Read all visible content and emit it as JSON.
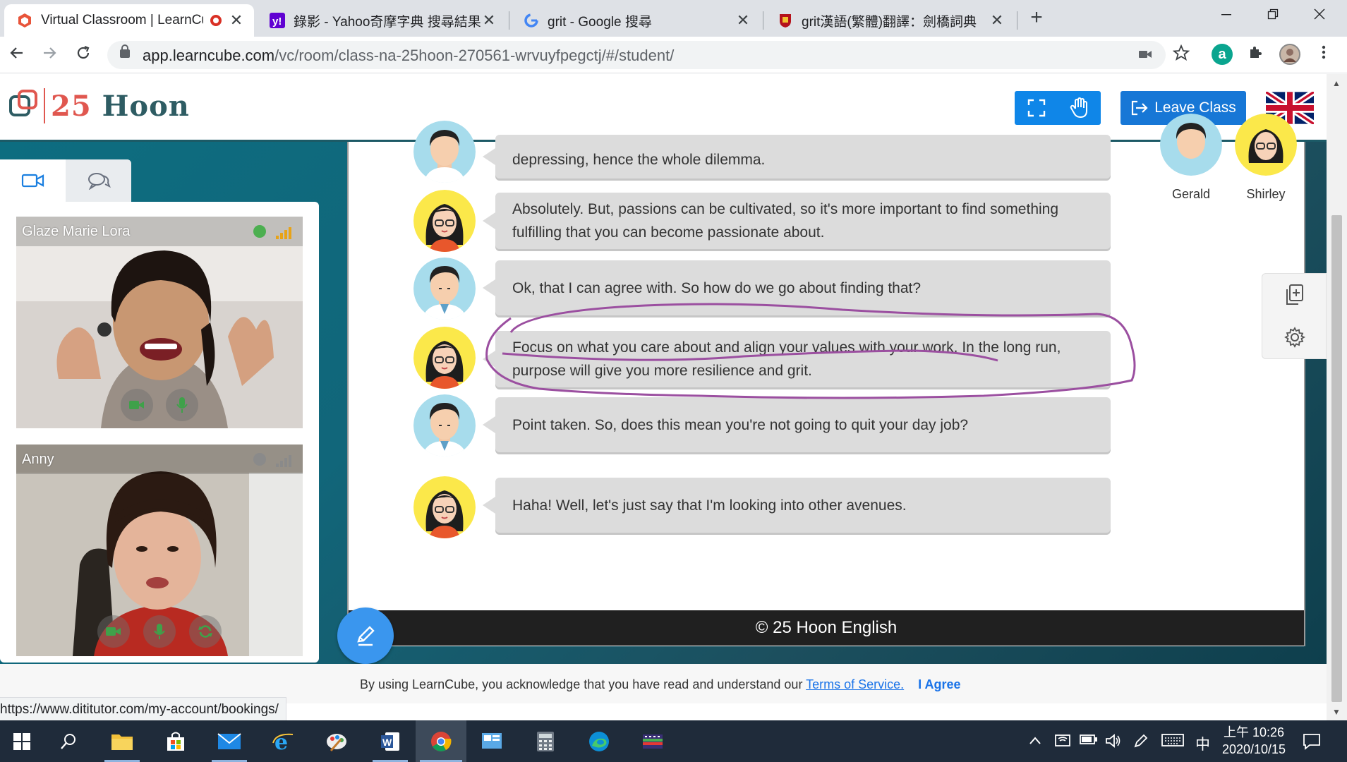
{
  "browser": {
    "tabs": [
      {
        "title": "Virtual Classroom | LearnCube",
        "favicon": "learncube-icon"
      },
      {
        "title": "錄影 - Yahoo奇摩字典 搜尋結果",
        "favicon": "yahoo-icon"
      },
      {
        "title": "grit - Google 搜尋",
        "favicon": "google-icon"
      },
      {
        "title": "grit漢語(繁體)翻譯：劍橋詞典",
        "favicon": "cambridge-icon"
      }
    ],
    "close_glyph": "✕",
    "new_tab_glyph": "+",
    "url_host": "app.learncube.com",
    "url_path": "/vc/room/class-na-25hoon-270561-wrvuyfpegctj/#/student/",
    "extension_letter": "a"
  },
  "app": {
    "logo_num": "25",
    "logo_word": "Hoon",
    "leave_label": "Leave Class",
    "accent_color": "#0f86e8"
  },
  "participants": [
    {
      "name": "Glaze Marie Lora",
      "status_color": "#4caf50",
      "signal_color": "#e8a317"
    },
    {
      "name": "Anny",
      "status_color": "#8a8a8a",
      "signal_color": "#8a8a8a"
    }
  ],
  "lesson": {
    "characters": [
      {
        "name": "Gerald"
      },
      {
        "name": "Shirley"
      }
    ],
    "dialogue": [
      {
        "speaker": "gerald",
        "text": "depressing, hence the whole dilemma."
      },
      {
        "speaker": "shirley",
        "text": "Absolutely. But, passions can be cultivated, so it's more important to find something fulfilling that you can become passionate about."
      },
      {
        "speaker": "gerald",
        "text": "Ok, that I can agree with. So how do we go about finding that?"
      },
      {
        "speaker": "shirley",
        "text": "Focus on what you care about and align your values with your work. In the long run, purpose will give you more resilience and grit."
      },
      {
        "speaker": "gerald",
        "text": "Point taken. So, does this mean you're not going to quit your day job?"
      },
      {
        "speaker": "shirley",
        "text": "Haha! Well, let's just say that I'm looking into other avenues."
      }
    ],
    "footer": "© 25 Hoon English"
  },
  "consent": {
    "text": "By using LearnCube, you acknowledge that you have read and understand our ",
    "link": "Terms of Service.",
    "agree": "I Agree"
  },
  "status_url": "https://www.dititutor.com/my-account/bookings/",
  "taskbar": {
    "ime": "中",
    "time": "上午 10:26",
    "date": "2020/10/15"
  }
}
